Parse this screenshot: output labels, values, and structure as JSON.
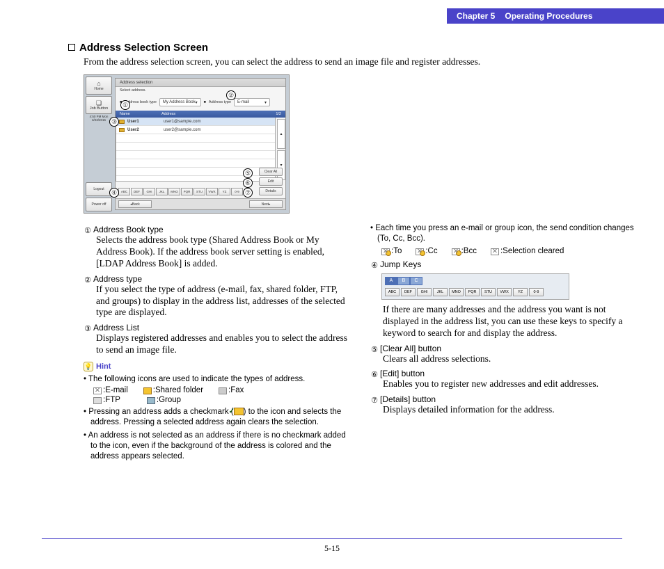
{
  "header": {
    "chapter": "Chapter 5",
    "title": "Operating Procedures"
  },
  "section": {
    "title": "Address Selection Screen",
    "intro": "From the address selection screen, you can select the address to send an image file and register addresses."
  },
  "screenshot": {
    "side_buttons": {
      "home": "Home",
      "jobbutton": "Job Button",
      "time_line1": "4:50 PM Mon",
      "time_line2": "3/23/2015",
      "logout": "Logout",
      "poweroff": "Power off"
    },
    "panel_title": "Address selection",
    "select_label": "Select address.",
    "addr_book_type_label": "Address book type",
    "addr_book_type_value": "My Address Book",
    "addr_type_label": "Address type",
    "addr_type_value": "E-mail",
    "thead_name": "Name",
    "thead_addr": "Address",
    "thead_page": "1/2",
    "rows": [
      {
        "name": "User1",
        "addr": "user1@sample.com",
        "selected": true
      },
      {
        "name": "User2",
        "addr": "user2@sample.com",
        "selected": false
      }
    ],
    "right_buttons": {
      "clear": "Clear All",
      "edit": "Edit",
      "details": "Details"
    },
    "jump_keys": [
      "ABC",
      "DEF",
      "GHI",
      "JKL",
      "MNO",
      "PQR",
      "STU",
      "VWX",
      "YZ",
      "0-9"
    ],
    "footer": {
      "back": "Back",
      "next": "Next"
    },
    "markers": {
      "m1": "1",
      "m2": "2",
      "m3": "3",
      "m4": "4",
      "m5": "5",
      "m6": "6",
      "m7": "7"
    }
  },
  "left_col": {
    "i1_title": "Address Book type",
    "i1_body": "Selects the address book type (Shared Address Book or My Address Book). If the address book server setting is enabled, [LDAP Address Book] is added.",
    "i2_title": "Address type",
    "i2_body": "If you select the type of address (e-mail, fax, shared folder, FTP, and groups) to display in the address list, addresses of the selected type are displayed.",
    "i3_title": "Address List",
    "i3_body": "Displays registered addresses and enables you to select the address to send an image file.",
    "hint_label": "Hint",
    "hint1": "The following icons are used to indicate the types of address.",
    "icon_email": ":E-mail",
    "icon_shared": ":Shared folder",
    "icon_fax": ":Fax",
    "icon_ftp": ":FTP",
    "icon_group": ":Group",
    "hint2a": "Pressing an address adds a checkmark (",
    "hint2b": ") to the icon and selects the address. Pressing a selected address again clears the selection.",
    "hint3": "An address is not selected as an address if there is no checkmark added to the icon, even if the background of the address is colored and the address appears selected."
  },
  "right_col": {
    "top_bullet": "Each time you press an e-mail or group icon, the send condition changes (To, Cc, Bcc).",
    "cond_to": ":To",
    "cond_cc": ":Cc",
    "cond_bcc": ":Bcc",
    "cond_clear": ":Selection cleared",
    "i4_title": "Jump Keys",
    "i4_body": "If there are many addresses and the address you want is not displayed in the address list, you can use these keys to specify a keyword to search for and display the address.",
    "i5_title": "[Clear All] button",
    "i5_body": "Clears all address selections.",
    "i6_title": "[Edit] button",
    "i6_body": "Enables you to register new addresses and edit addresses.",
    "i7_title": "[Details] button",
    "i7_body": "Displays detailed information for the address.",
    "jump_tabs": [
      "A",
      "B",
      "C"
    ],
    "jump_keys": [
      "ABC",
      "DEF",
      "GHI",
      "JKL",
      "MNO",
      "PQR",
      "STU",
      "VWX",
      "YZ",
      "0-9"
    ]
  },
  "page_no": "5-15",
  "circled": {
    "c1": "①",
    "c2": "②",
    "c3": "③",
    "c4": "④",
    "c5": "⑤",
    "c6": "⑥",
    "c7": "⑦"
  }
}
